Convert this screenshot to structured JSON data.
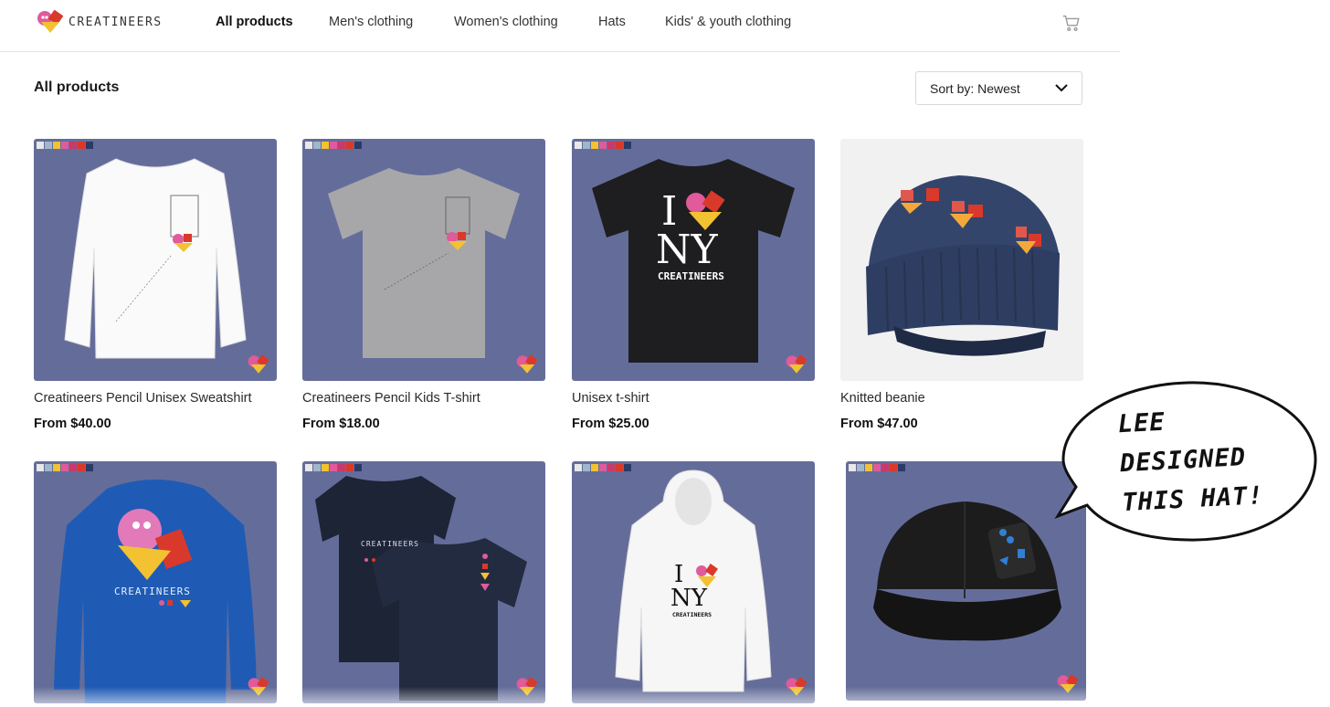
{
  "brand": {
    "name": "CREATINEERS"
  },
  "nav": {
    "items": [
      {
        "label": "All products",
        "active": true
      },
      {
        "label": "Men's clothing",
        "active": false
      },
      {
        "label": "Women's clothing",
        "active": false
      },
      {
        "label": "Hats",
        "active": false
      },
      {
        "label": "Kids' & youth clothing",
        "active": false
      }
    ],
    "cart_icon": "shopping-cart-icon"
  },
  "page_title": "All products",
  "sort": {
    "label": "Sort by: Newest",
    "icon": "chevron-down-icon"
  },
  "colors": {
    "product_bg": "#646d9a",
    "brand_pink": "#e05a9c",
    "brand_red": "#d9392b",
    "brand_yellow": "#f2c232"
  },
  "products": [
    {
      "name": "Creatineers Pencil Unisex Sweatshirt",
      "price": "From $40.00",
      "image": "white-sweatshirt"
    },
    {
      "name": "Creatineers Pencil Kids T-shirt",
      "price": "From $18.00",
      "image": "grey-kids-tshirt"
    },
    {
      "name": "Unisex t-shirt",
      "price": "From $25.00",
      "image": "black-tshirt",
      "print_lines": [
        "I",
        "NY",
        "CREATINEERS"
      ]
    },
    {
      "name": "Knitted beanie",
      "price": "From $47.00",
      "image": "navy-beanie"
    },
    {
      "name": "",
      "price": "",
      "image": "blue-hoodie",
      "print_lines": [
        "CREATINEERS"
      ]
    },
    {
      "name": "",
      "price": "",
      "image": "navy-tshirts",
      "print_lines": [
        "CREATINEERS"
      ]
    },
    {
      "name": "",
      "price": "",
      "image": "white-hoodie",
      "print_lines": [
        "I",
        "NY",
        "CREATINEERS"
      ]
    },
    {
      "name": "",
      "price": "",
      "image": "black-cap"
    }
  ],
  "bubble": {
    "lines": [
      "LEE",
      "DESIGNED",
      "THIS HAT!"
    ]
  }
}
